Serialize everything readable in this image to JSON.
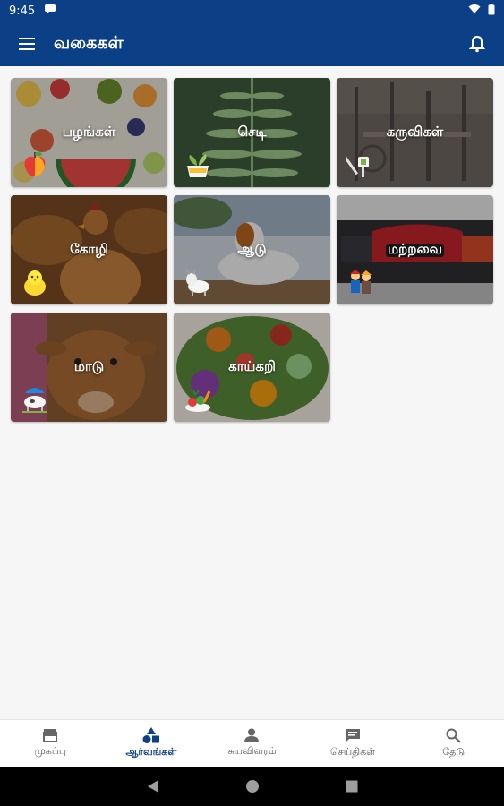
{
  "status": {
    "time": "9:45"
  },
  "appbar": {
    "title": "வகைகள்"
  },
  "colors": {
    "primary": "#0b3f86",
    "background": "#f6f6f6"
  },
  "categories": [
    {
      "label": "பழங்கள்",
      "emblem": "apple-icon"
    },
    {
      "label": "செடி",
      "emblem": "plant-pot-icon"
    },
    {
      "label": "கருவிகள்",
      "emblem": "tools-icon"
    },
    {
      "label": "கோழி",
      "emblem": "chick-icon"
    },
    {
      "label": "ஆடு",
      "emblem": "goat-icon"
    },
    {
      "label": "மற்றவை",
      "emblem": "farmers-icon"
    },
    {
      "label": "மாடு",
      "emblem": "cow-icon"
    },
    {
      "label": "காய்கறி",
      "emblem": "vegetables-icon"
    }
  ],
  "bottom_nav": [
    {
      "label": "முகப்பு",
      "icon": "store-icon",
      "active": false
    },
    {
      "label": "ஆர்வங்கள்",
      "icon": "shapes-icon",
      "active": true
    },
    {
      "label": "சுயவிவரம்",
      "icon": "person-icon",
      "active": false
    },
    {
      "label": "செய்திகள்",
      "icon": "message-icon",
      "active": false
    },
    {
      "label": "தேடு",
      "icon": "search-icon",
      "active": false
    }
  ]
}
